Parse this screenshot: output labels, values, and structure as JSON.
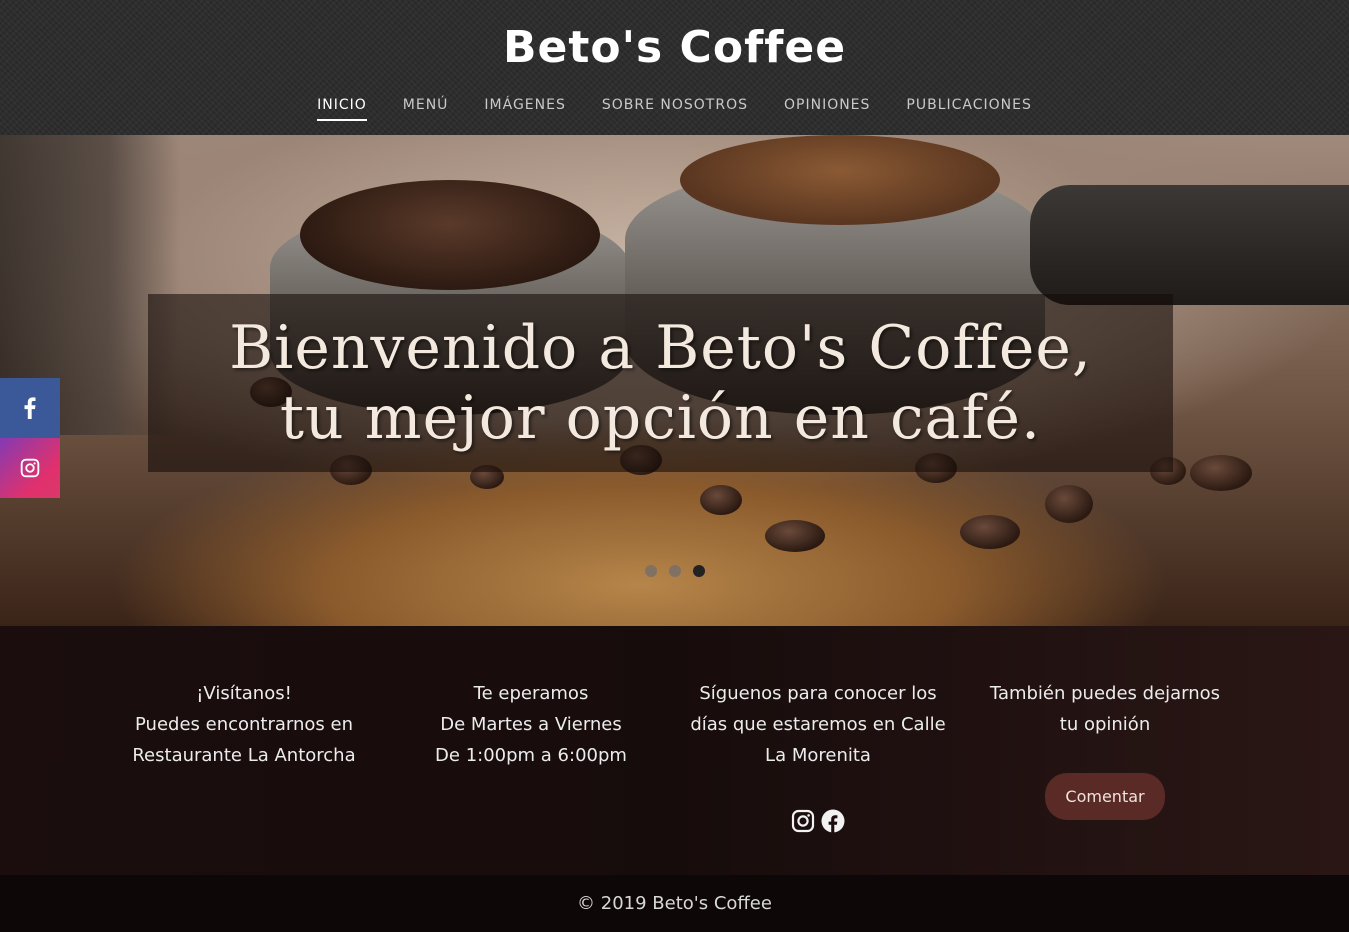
{
  "header": {
    "brand": "Beto's Coffee",
    "nav": [
      {
        "label": "INICIO",
        "active": true
      },
      {
        "label": "MENÚ"
      },
      {
        "label": "IMÁGENES"
      },
      {
        "label": "SOBRE NOSOTROS"
      },
      {
        "label": "OPINIONES"
      },
      {
        "label": "PUBLICACIONES"
      }
    ]
  },
  "hero": {
    "line1": "Bienvenido a Beto's Coffee,",
    "line2": "tu mejor opción en café.",
    "slide_count": 3,
    "active_slide": 3
  },
  "social": {
    "items": [
      "facebook-icon",
      "instagram-icon"
    ],
    "colors": {
      "facebook": "#3b5998",
      "instagram": "#c13584"
    }
  },
  "info": {
    "col1": [
      "¡Visítanos!",
      "Puedes encontrarnos en",
      "Restaurante La Antorcha"
    ],
    "col2": [
      "Te eperamos",
      "De Martes a Viernes",
      "De 1:00pm a 6:00pm"
    ],
    "col3": [
      "Síguenos para conocer los",
      "días que estaremos en Calle",
      "La Morenita"
    ],
    "col4": [
      "También puedes dejarnos",
      "tu opinión"
    ],
    "comment_button": "Comentar"
  },
  "footer": {
    "copyright": "© 2019 Beto's Coffee"
  },
  "colors": {
    "header_bg": "#2b2b2b",
    "info_bg": "#1b0d0d",
    "button_bg": "#5a2a26"
  }
}
